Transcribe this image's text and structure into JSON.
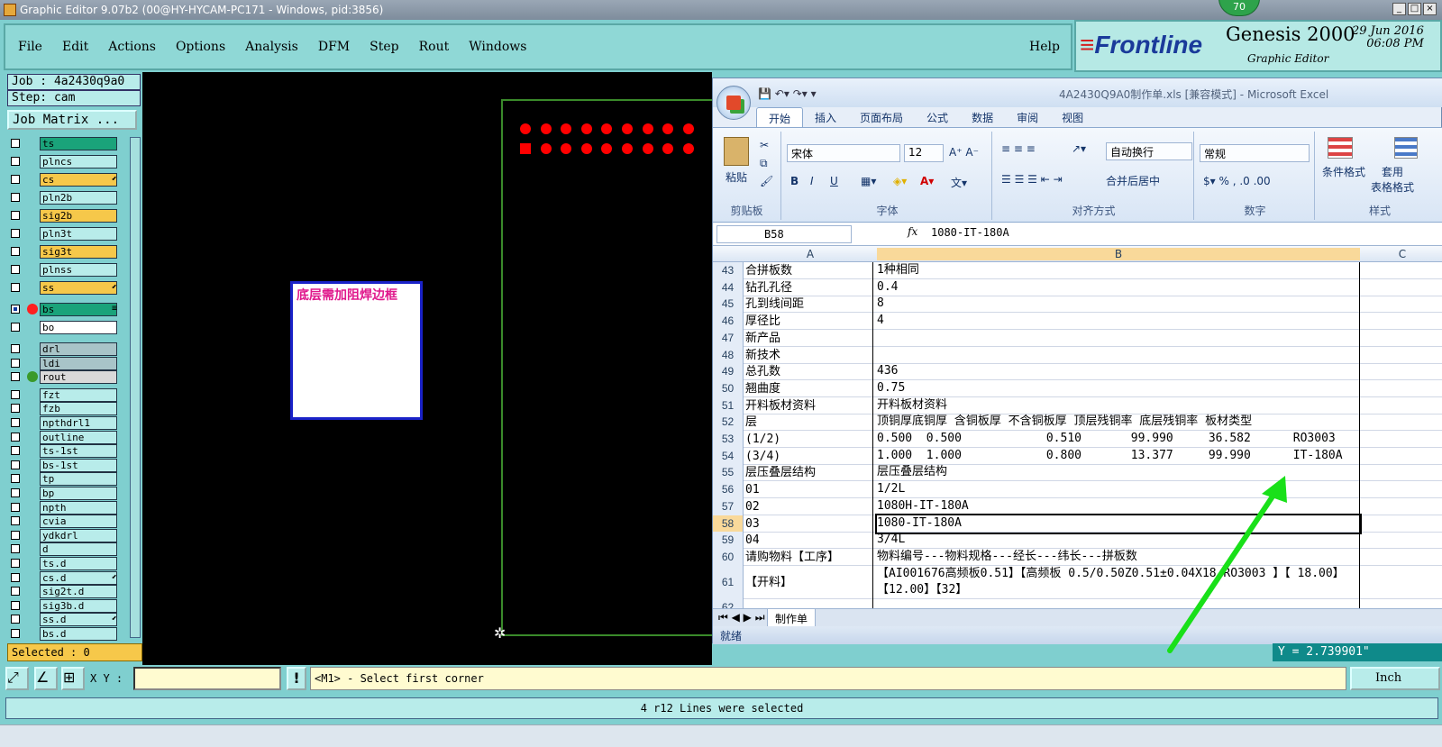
{
  "window": {
    "title": "Graphic Editor 9.07b2 (00@HY-HYCAM-PC171 - Windows, pid:3856)",
    "badge": "70"
  },
  "menu": {
    "items": [
      "File",
      "Edit",
      "Actions",
      "Options",
      "Analysis",
      "DFM",
      "Step",
      "Rout",
      "Windows"
    ],
    "help": "Help"
  },
  "brand": {
    "logo": "Frontline",
    "product": "Genesis 2000",
    "subtitle": "Graphic Editor",
    "date": "29 Jun 2016",
    "time": "06:08 PM"
  },
  "job": {
    "job": "Job : 4a2430q9a0",
    "step": "Step: cam",
    "matrix": "Job Matrix ..."
  },
  "layers": [
    {
      "name": "ts",
      "color": "#1aa37a",
      "cb": "",
      "dot": ""
    },
    {
      "name": "plncs",
      "color": "#b8ecea",
      "cb": "",
      "dot": ""
    },
    {
      "name": "cs",
      "color": "#f6c84a",
      "cb": "",
      "dot": "",
      "arrow": "⬋"
    },
    {
      "name": "pln2b",
      "color": "#b8ecea",
      "cb": "",
      "dot": ""
    },
    {
      "name": "sig2b",
      "color": "#f6c84a",
      "cb": "",
      "dot": ""
    },
    {
      "name": "pln3t",
      "color": "#b8ecea",
      "cb": "",
      "dot": ""
    },
    {
      "name": "sig3t",
      "color": "#f6c84a",
      "cb": "",
      "dot": ""
    },
    {
      "name": "plnss",
      "color": "#b8ecea",
      "cb": "",
      "dot": ""
    },
    {
      "name": "ss",
      "color": "#f6c84a",
      "cb": "",
      "dot": "",
      "arrow": "⬋"
    },
    {
      "name": "bs",
      "color": "#1aa37a",
      "cb": "sel",
      "dot": "#ff2020",
      "arrow": "≡"
    },
    {
      "name": "bo",
      "color": "#ffffff",
      "cb": "",
      "dot": ""
    },
    {
      "name": "drl",
      "color": "#a8c4c8",
      "cb": "",
      "dot": ""
    },
    {
      "name": "ldi",
      "color": "#a8c4c8",
      "cb": "",
      "dot": ""
    },
    {
      "name": "rout",
      "color": "#d9d9d9",
      "cb": "",
      "dot": "#3a9a2a"
    },
    {
      "name": "fzt",
      "color": "#b8ecea",
      "cb": "",
      "dot": ""
    },
    {
      "name": "fzb",
      "color": "#b8ecea",
      "cb": "",
      "dot": ""
    },
    {
      "name": "npthdrl1",
      "color": "#b8ecea",
      "cb": "",
      "dot": ""
    },
    {
      "name": "outline",
      "color": "#b8ecea",
      "cb": "",
      "dot": ""
    },
    {
      "name": "ts-1st",
      "color": "#b8ecea",
      "cb": "",
      "dot": ""
    },
    {
      "name": "bs-1st",
      "color": "#b8ecea",
      "cb": "",
      "dot": ""
    },
    {
      "name": "tp",
      "color": "#b8ecea",
      "cb": "",
      "dot": ""
    },
    {
      "name": "bp",
      "color": "#b8ecea",
      "cb": "",
      "dot": ""
    },
    {
      "name": "npth",
      "color": "#b8ecea",
      "cb": "",
      "dot": ""
    },
    {
      "name": "cvia",
      "color": "#b8ecea",
      "cb": "",
      "dot": ""
    },
    {
      "name": "ydkdrl",
      "color": "#b8ecea",
      "cb": "",
      "dot": ""
    },
    {
      "name": "d",
      "color": "#b8ecea",
      "cb": "",
      "dot": ""
    },
    {
      "name": "ts.d",
      "color": "#b8ecea",
      "cb": "",
      "dot": ""
    },
    {
      "name": "cs.d",
      "color": "#b8ecea",
      "cb": "",
      "dot": "",
      "arrow": "⬋"
    },
    {
      "name": "sig2t.d",
      "color": "#b8ecea",
      "cb": "",
      "dot": ""
    },
    {
      "name": "sig3b.d",
      "color": "#b8ecea",
      "cb": "",
      "dot": ""
    },
    {
      "name": "ss.d",
      "color": "#b8ecea",
      "cb": "",
      "dot": "",
      "arrow": "⬋"
    },
    {
      "name": "bs.d",
      "color": "#b8ecea",
      "cb": "",
      "dot": ""
    }
  ],
  "selected": "Selected : 0",
  "canvas": {
    "note": "底层需加阻焊边框"
  },
  "excel": {
    "title": "4A2430Q9A0制作单.xls [兼容模式] - Microsoft Excel",
    "tabs": [
      "开始",
      "插入",
      "页面布局",
      "公式",
      "数据",
      "审阅",
      "视图"
    ],
    "groups": {
      "clipboard": "剪贴板",
      "font": "字体",
      "align": "对齐方式",
      "number": "数字",
      "style": "样式"
    },
    "paste": "粘贴",
    "font_name": "宋体",
    "font_size": "12",
    "wrap": "自动换行",
    "merge": "合并后居中",
    "number_format": "常规",
    "cond_format": "条件格式",
    "table_format": "套用\n表格格式",
    "name_box": "B58",
    "formula": "1080-IT-180A",
    "columns": [
      "A",
      "B",
      "C"
    ],
    "rows": [
      {
        "n": "43",
        "a": "合拼板数",
        "b": "1种相同"
      },
      {
        "n": "44",
        "a": "钻孔孔径",
        "b": "0.4"
      },
      {
        "n": "45",
        "a": "孔到线间距",
        "b": "8"
      },
      {
        "n": "46",
        "a": "厚径比",
        "b": "4"
      },
      {
        "n": "47",
        "a": "新产品",
        "b": ""
      },
      {
        "n": "48",
        "a": "新技术",
        "b": ""
      },
      {
        "n": "49",
        "a": "总孔数",
        "b": "436"
      },
      {
        "n": "50",
        "a": "翘曲度",
        "b": "0.75"
      },
      {
        "n": "51",
        "a": "开料板材资料",
        "b": "开料板材资料"
      },
      {
        "n": "52",
        "a": "层",
        "b": "顶铜厚底铜厚 含铜板厚 不含铜板厚 顶层残铜率 底层残铜率 板材类型"
      },
      {
        "n": "53",
        "a": "(1/2)",
        "b": "0.500  0.500            0.510       99.990     36.582      RO3003"
      },
      {
        "n": "54",
        "a": "(3/4)",
        "b": "1.000  1.000            0.800       13.377     99.990      IT-180A"
      },
      {
        "n": "55",
        "a": "层压叠层结构",
        "b": "层压叠层结构"
      },
      {
        "n": "56",
        "a": "01",
        "b": "1/2L"
      },
      {
        "n": "57",
        "a": "02",
        "b": "1080H-IT-180A"
      },
      {
        "n": "58",
        "a": "03",
        "b": "1080-IT-180A"
      },
      {
        "n": "59",
        "a": "04",
        "b": "3/4L"
      },
      {
        "n": "60",
        "a": "请购物料【工序】",
        "b": "物料编号---物料规格---经长---纬长---拼板数"
      },
      {
        "n": "61",
        "a": "【开料】",
        "b": "【AI001676高频板0.51】【高频板 0.5/0.50Z0.51±0.04X18  RO3003 】【 18.00】【12.00】【32】"
      },
      {
        "n": "62",
        "a": "",
        "b": ""
      }
    ],
    "sheet": "制作单",
    "status": "就绪"
  },
  "y_readout": "Y = 2.739901\"",
  "bottom": {
    "xy_label": "X Y :",
    "info": "!",
    "prompt": "<M1> - Select first corner",
    "units": "Inch"
  },
  "status": "4 r12 Lines were selected"
}
